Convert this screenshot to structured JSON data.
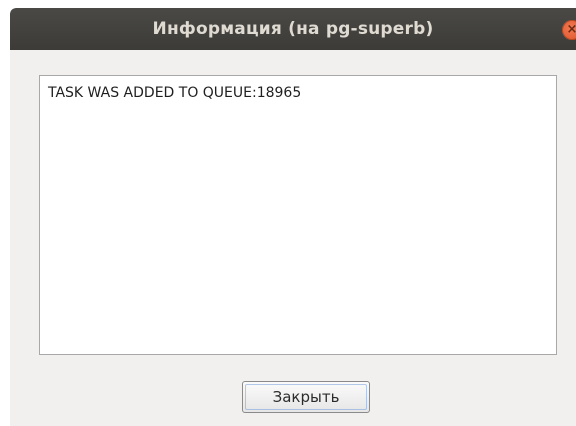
{
  "window": {
    "title": "Информация (на pg-superb)",
    "close_icon": "×"
  },
  "message": {
    "text": "TASK WAS ADDED TO QUEUE:18965"
  },
  "footer": {
    "close_label": "Закрыть"
  },
  "colors": {
    "titlebar": "#3c3b37",
    "close_button": "#e0532a",
    "dialog_background": "#f1f0ef"
  }
}
